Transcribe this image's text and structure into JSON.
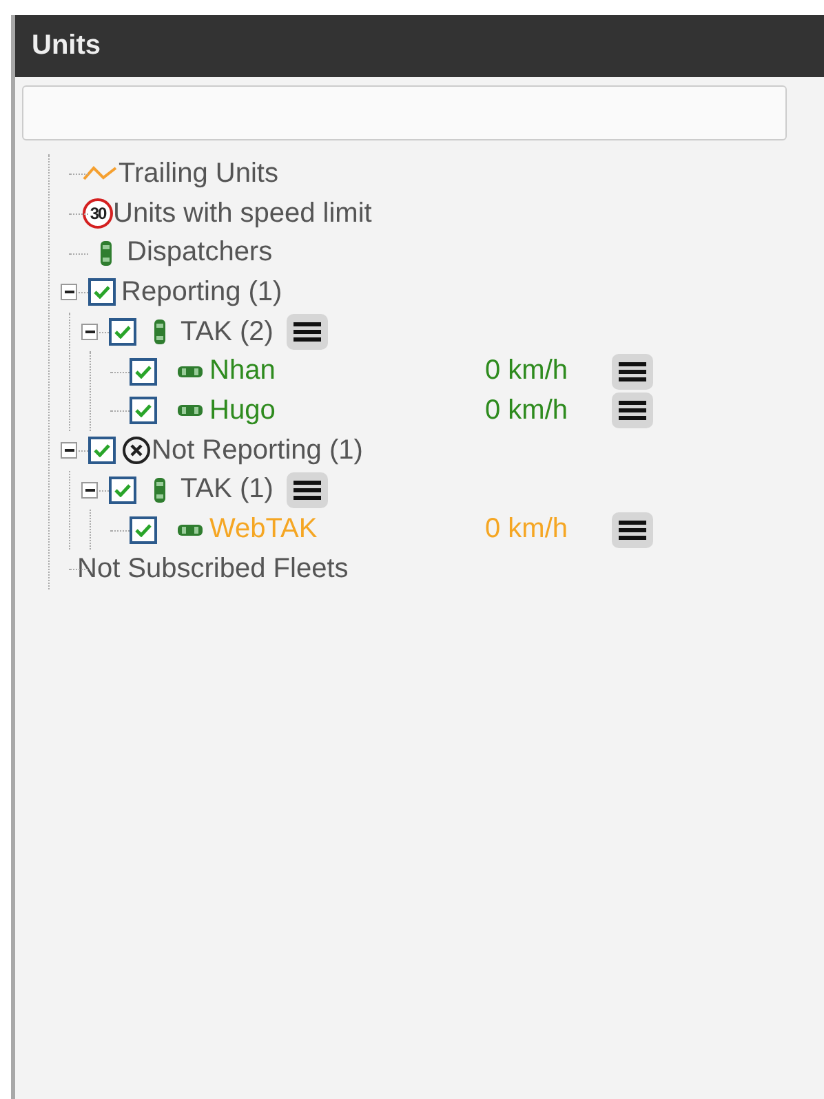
{
  "panel": {
    "title": "Units"
  },
  "tree": [
    {
      "kind": "trailing",
      "label": "Trailing Units"
    },
    {
      "kind": "speed_limit",
      "badge": "30",
      "label": "Units with speed limit"
    },
    {
      "kind": "dispatchers",
      "label": "Dispatchers"
    },
    {
      "kind": "group",
      "label": "Reporting (1)",
      "reporting": true,
      "checked": true,
      "expanded": true,
      "children": [
        {
          "kind": "fleet",
          "label": "TAK (2)",
          "checked": true,
          "expanded": true,
          "children": [
            {
              "kind": "unit",
              "label": "Nhan",
              "speed": "0 km/h",
              "checked": true,
              "color": "#2e8b1e"
            },
            {
              "kind": "unit",
              "label": "Hugo",
              "speed": "0 km/h",
              "checked": true,
              "color": "#2e8b1e"
            }
          ]
        }
      ]
    },
    {
      "kind": "group",
      "label": "Not Reporting (1)",
      "reporting": false,
      "checked": true,
      "expanded": true,
      "children": [
        {
          "kind": "fleet",
          "label": "TAK (1)",
          "checked": true,
          "expanded": true,
          "children": [
            {
              "kind": "unit",
              "label": "WebTAK",
              "speed": "0 km/h",
              "checked": true,
              "color": "#f5a623"
            }
          ]
        }
      ]
    },
    {
      "kind": "plain",
      "label": "Not Subscribed Fleets"
    }
  ]
}
